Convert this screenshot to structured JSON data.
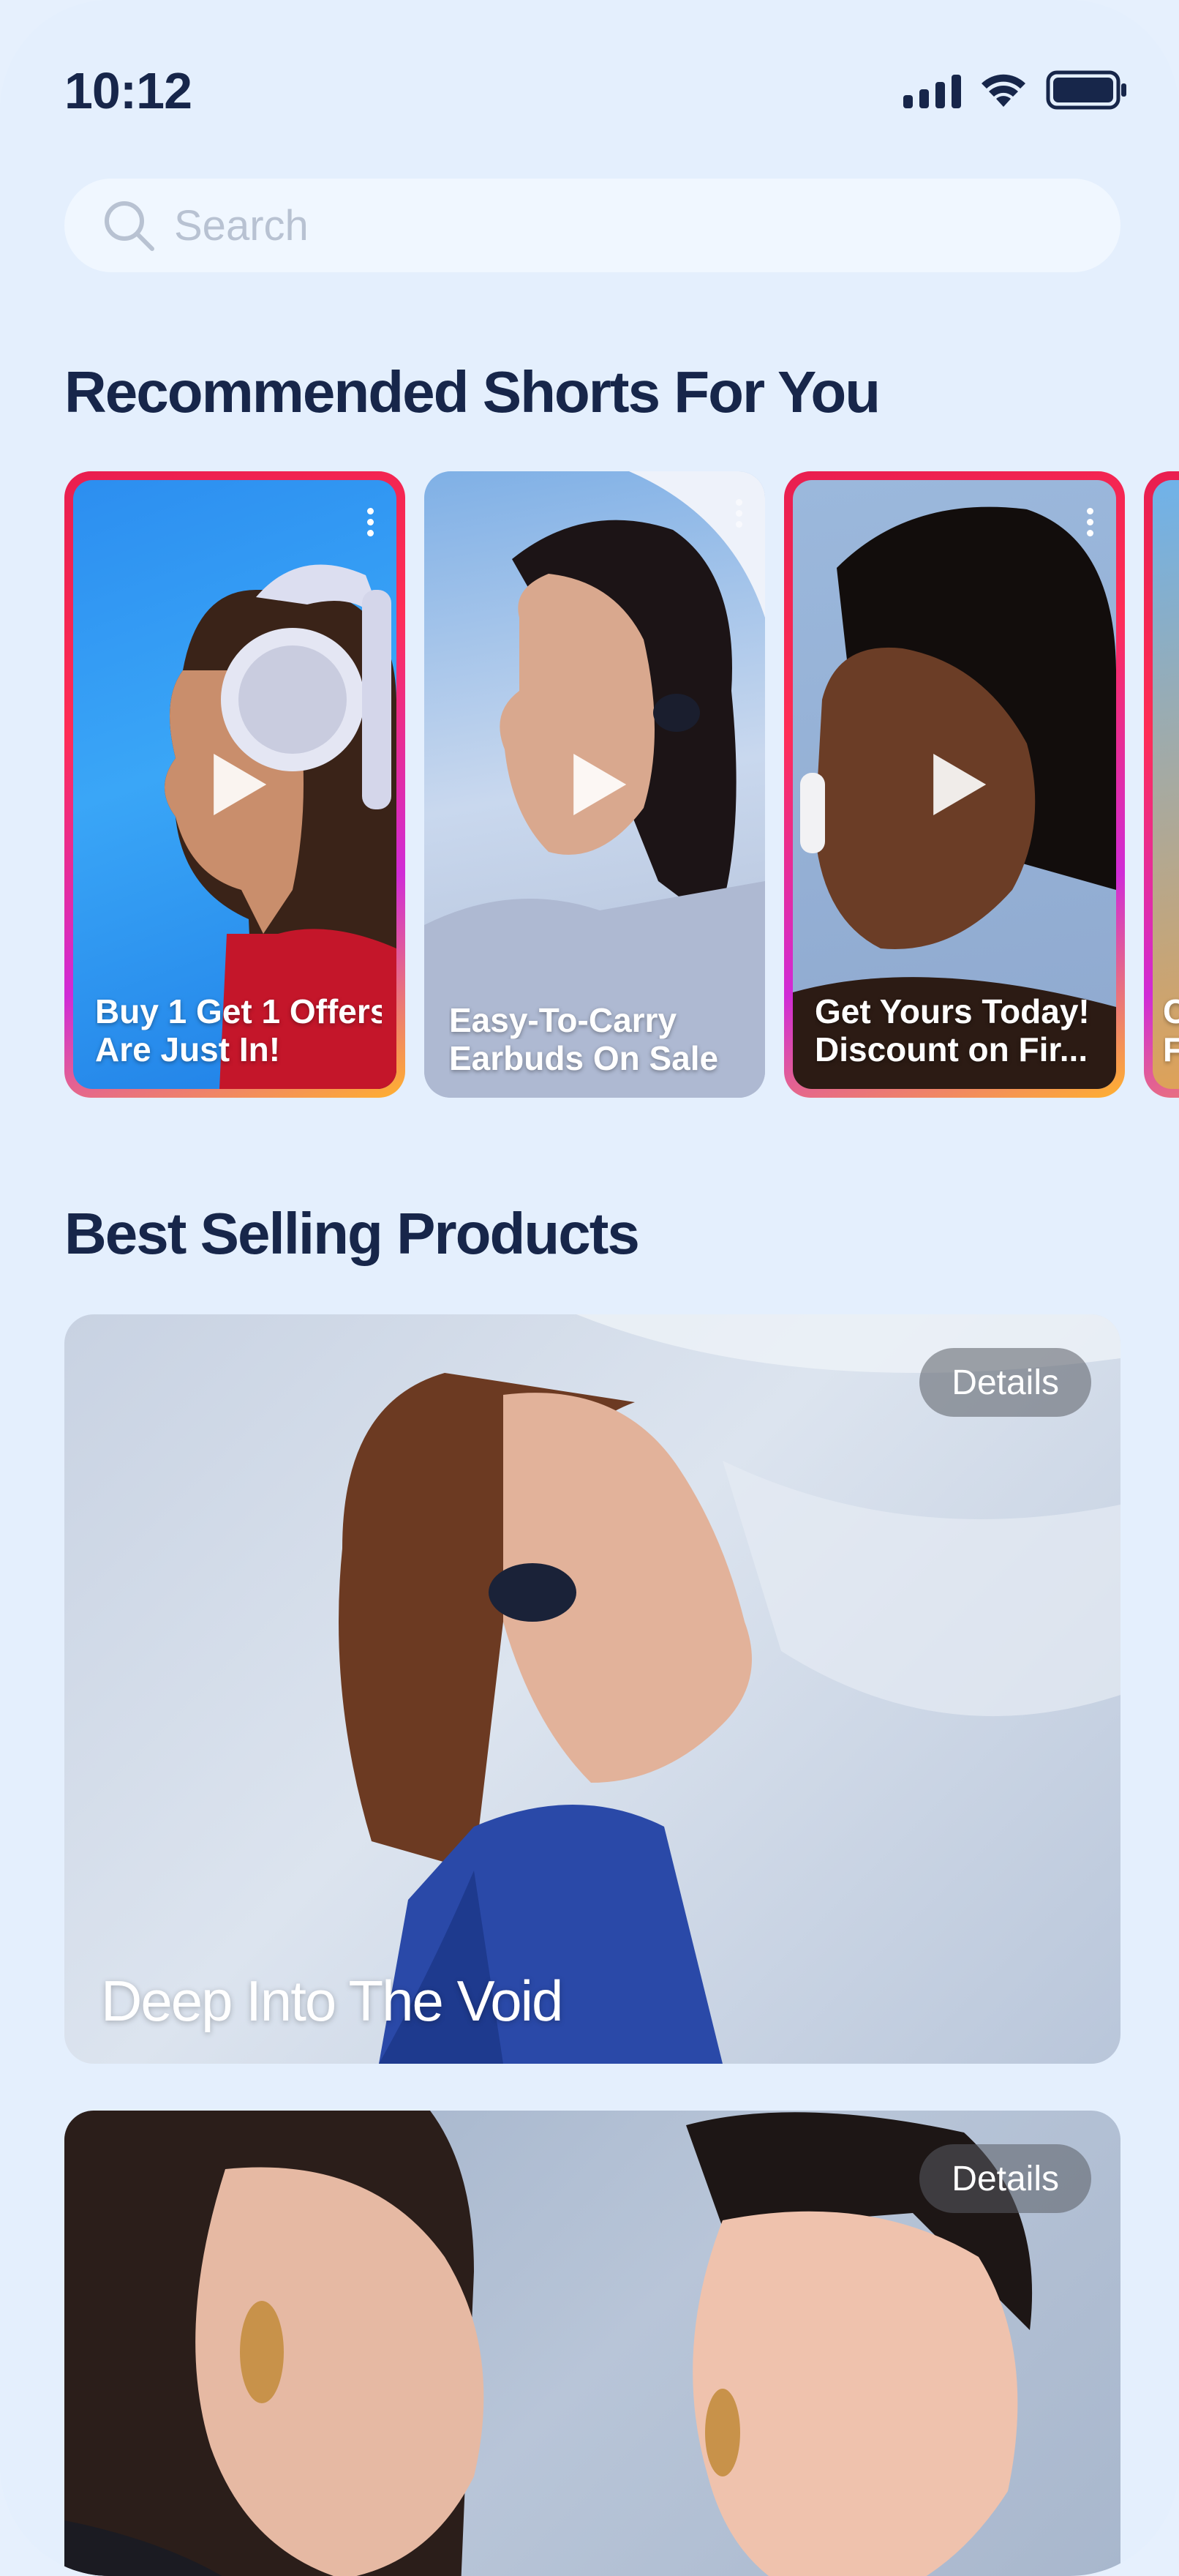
{
  "status_bar": {
    "time": "10:12",
    "icons": [
      "signal-icon",
      "wifi-icon",
      "battery-icon"
    ]
  },
  "search": {
    "placeholder": "Search",
    "value": ""
  },
  "shorts_section": {
    "title": "Recommended Shorts For You",
    "items": [
      {
        "caption_line1": "Buy 1 Get 1 Offers",
        "caption_line2": "Are Just In!",
        "highlighted": true
      },
      {
        "caption_line1": "Easy-To-Carry",
        "caption_line2": "Earbuds On Sale",
        "highlighted": false
      },
      {
        "caption_line1": "Get Yours Today!",
        "caption_line2": "Discount on Fir...",
        "highlighted": true
      },
      {
        "caption_line1": "C",
        "caption_line2": "F",
        "highlighted": true
      }
    ]
  },
  "best_selling": {
    "title": "Best Selling Products",
    "products": [
      {
        "name": "Deep Into The Void",
        "details_label": "Details"
      },
      {
        "name": "",
        "details_label": "Details"
      }
    ]
  },
  "colors": {
    "background": "#e4effd",
    "text_primary": "#17264a",
    "ring_gradient": [
      "#e91e4f",
      "#d02bd6",
      "#ffb12f"
    ]
  }
}
